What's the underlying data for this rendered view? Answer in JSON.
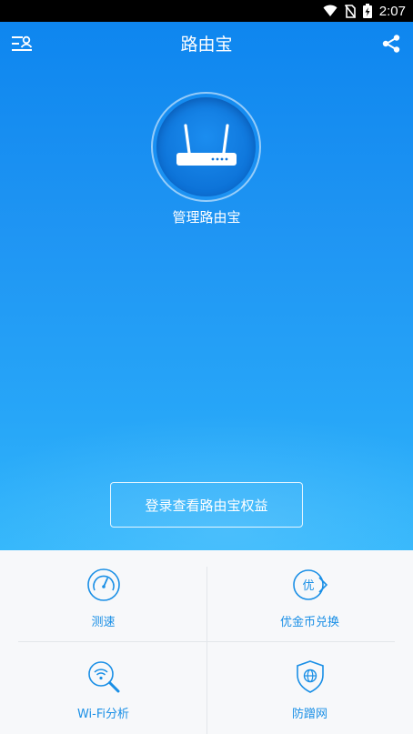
{
  "status_bar": {
    "time": "2:07",
    "icons": [
      "wifi-icon",
      "no-sim-icon",
      "battery-charging-icon"
    ]
  },
  "app_bar": {
    "title": "路由宝",
    "left_icon": "menu-profile-icon",
    "right_icon": "share-icon"
  },
  "router": {
    "label": "管理路由宝",
    "icon": "router-icon"
  },
  "login_button": "登录查看路由宝权益",
  "features": [
    {
      "label": "测速",
      "icon": "speedometer-icon"
    },
    {
      "label": "优金币兑换",
      "icon": "coin-exchange-icon"
    },
    {
      "label": "Wi-Fi分析",
      "icon": "wifi-search-icon"
    },
    {
      "label": "防蹭网",
      "icon": "shield-globe-icon"
    }
  ],
  "colors": {
    "accent": "#1a8fe6",
    "hero_top": "#0e86ef",
    "hero_bottom": "#32b6fb"
  }
}
